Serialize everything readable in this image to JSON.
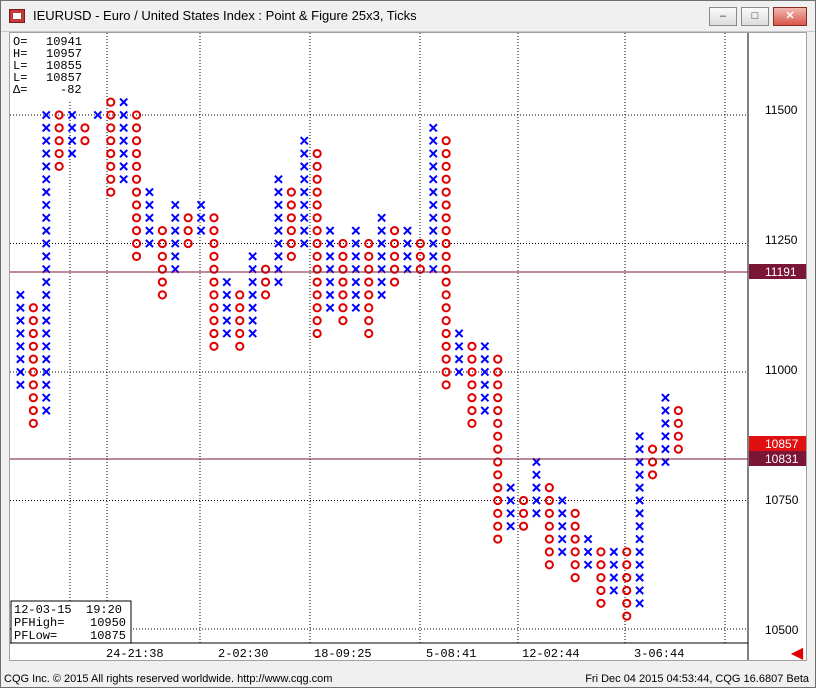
{
  "window": {
    "title": "IEURUSD - Euro / United States Index : Point & Figure 25x3, Ticks",
    "minimize_glyph": "–",
    "maximize_glyph": "□",
    "close_glyph": "✕"
  },
  "ohlc": [
    {
      "label": "O=",
      "value": "10941"
    },
    {
      "label": "H=",
      "value": "10957"
    },
    {
      "label": "L=",
      "value": "10855"
    },
    {
      "label": "L=",
      "value": "10857"
    },
    {
      "label": "Δ=",
      "value": "-82"
    }
  ],
  "info_box": {
    "date": "12-03-15",
    "time": "19:20",
    "pfhigh_label": "PFHigh=",
    "pfhigh_value": "10950",
    "pflow_label": "PFLow=",
    "pflow_value": "10875"
  },
  "price_axis": [
    "11500",
    "11250",
    "11000",
    "10750",
    "10500"
  ],
  "price_markers": [
    {
      "value": "11191",
      "color": "#7a1535"
    },
    {
      "value": "10857",
      "color": "#e01010"
    },
    {
      "value": "10831",
      "color": "#7a1535"
    }
  ],
  "time_axis": [
    "24-21:38",
    "2-02:30",
    "18-09:25",
    "5-08:41",
    "12-02:44",
    "3-06:44"
  ],
  "footer": {
    "left": "CQG Inc. © 2015 All rights reserved worldwide. http://www.cqg.com",
    "right": "Fri Dec 04 2015 04:53:44, CQG 16.6807 Beta"
  },
  "chart_data": {
    "type": "point-and-figure",
    "box_size": 25,
    "reversal": 3,
    "ylim": [
      10475,
      11575
    ],
    "colors": {
      "x": "#0000ff",
      "o": "#e00000"
    },
    "columns": [
      {
        "type": "X",
        "low": 10975,
        "high": 11150
      },
      {
        "type": "O",
        "low": 10900,
        "high": 11125
      },
      {
        "type": "X",
        "low": 10925,
        "high": 11500
      },
      {
        "type": "O",
        "low": 11400,
        "high": 11500
      },
      {
        "type": "X",
        "low": 11425,
        "high": 11500
      },
      {
        "type": "O",
        "low": 11450,
        "high": 11475
      },
      {
        "type": "X",
        "low": 11500,
        "high": 11500
      },
      {
        "type": "O",
        "low": 11350,
        "high": 11525
      },
      {
        "type": "X",
        "low": 11375,
        "high": 11525
      },
      {
        "type": "O",
        "low": 11225,
        "high": 11500
      },
      {
        "type": "X",
        "low": 11250,
        "high": 11350
      },
      {
        "type": "O",
        "low": 11150,
        "high": 11275
      },
      {
        "type": "X",
        "low": 11200,
        "high": 11325
      },
      {
        "type": "O",
        "low": 11250,
        "high": 11300
      },
      {
        "type": "X",
        "low": 11275,
        "high": 11325
      },
      {
        "type": "O",
        "low": 11050,
        "high": 11300
      },
      {
        "type": "X",
        "low": 11075,
        "high": 11175
      },
      {
        "type": "O",
        "low": 11050,
        "high": 11150
      },
      {
        "type": "X",
        "low": 11075,
        "high": 11225
      },
      {
        "type": "O",
        "low": 11150,
        "high": 11200
      },
      {
        "type": "X",
        "low": 11175,
        "high": 11375
      },
      {
        "type": "O",
        "low": 11225,
        "high": 11350
      },
      {
        "type": "X",
        "low": 11250,
        "high": 11450
      },
      {
        "type": "O",
        "low": 11075,
        "high": 11425
      },
      {
        "type": "X",
        "low": 11125,
        "high": 11275
      },
      {
        "type": "O",
        "low": 11100,
        "high": 11250
      },
      {
        "type": "X",
        "low": 11125,
        "high": 11275
      },
      {
        "type": "O",
        "low": 11075,
        "high": 11250
      },
      {
        "type": "X",
        "low": 11150,
        "high": 11300
      },
      {
        "type": "O",
        "low": 11175,
        "high": 11275
      },
      {
        "type": "X",
        "low": 11200,
        "high": 11275
      },
      {
        "type": "O",
        "low": 11200,
        "high": 11250
      },
      {
        "type": "X",
        "low": 11200,
        "high": 11475
      },
      {
        "type": "O",
        "low": 10975,
        "high": 11450
      },
      {
        "type": "X",
        "low": 11000,
        "high": 11075
      },
      {
        "type": "O",
        "low": 10900,
        "high": 11050
      },
      {
        "type": "X",
        "low": 10925,
        "high": 11050
      },
      {
        "type": "O",
        "low": 10675,
        "high": 11025
      },
      {
        "type": "X",
        "low": 10700,
        "high": 10775
      },
      {
        "type": "O",
        "low": 10700,
        "high": 10750
      },
      {
        "type": "X",
        "low": 10725,
        "high": 10825
      },
      {
        "type": "O",
        "low": 10625,
        "high": 10775
      },
      {
        "type": "X",
        "low": 10650,
        "high": 10750
      },
      {
        "type": "O",
        "low": 10600,
        "high": 10725
      },
      {
        "type": "X",
        "low": 10625,
        "high": 10675
      },
      {
        "type": "O",
        "low": 10550,
        "high": 10650
      },
      {
        "type": "X",
        "low": 10575,
        "high": 10650
      },
      {
        "type": "O",
        "low": 10525,
        "high": 10650
      },
      {
        "type": "X",
        "low": 10550,
        "high": 10875
      },
      {
        "type": "O",
        "low": 10800,
        "high": 10850
      },
      {
        "type": "X",
        "low": 10825,
        "high": 10950
      },
      {
        "type": "O",
        "low": 10850,
        "high": 10925
      }
    ]
  }
}
